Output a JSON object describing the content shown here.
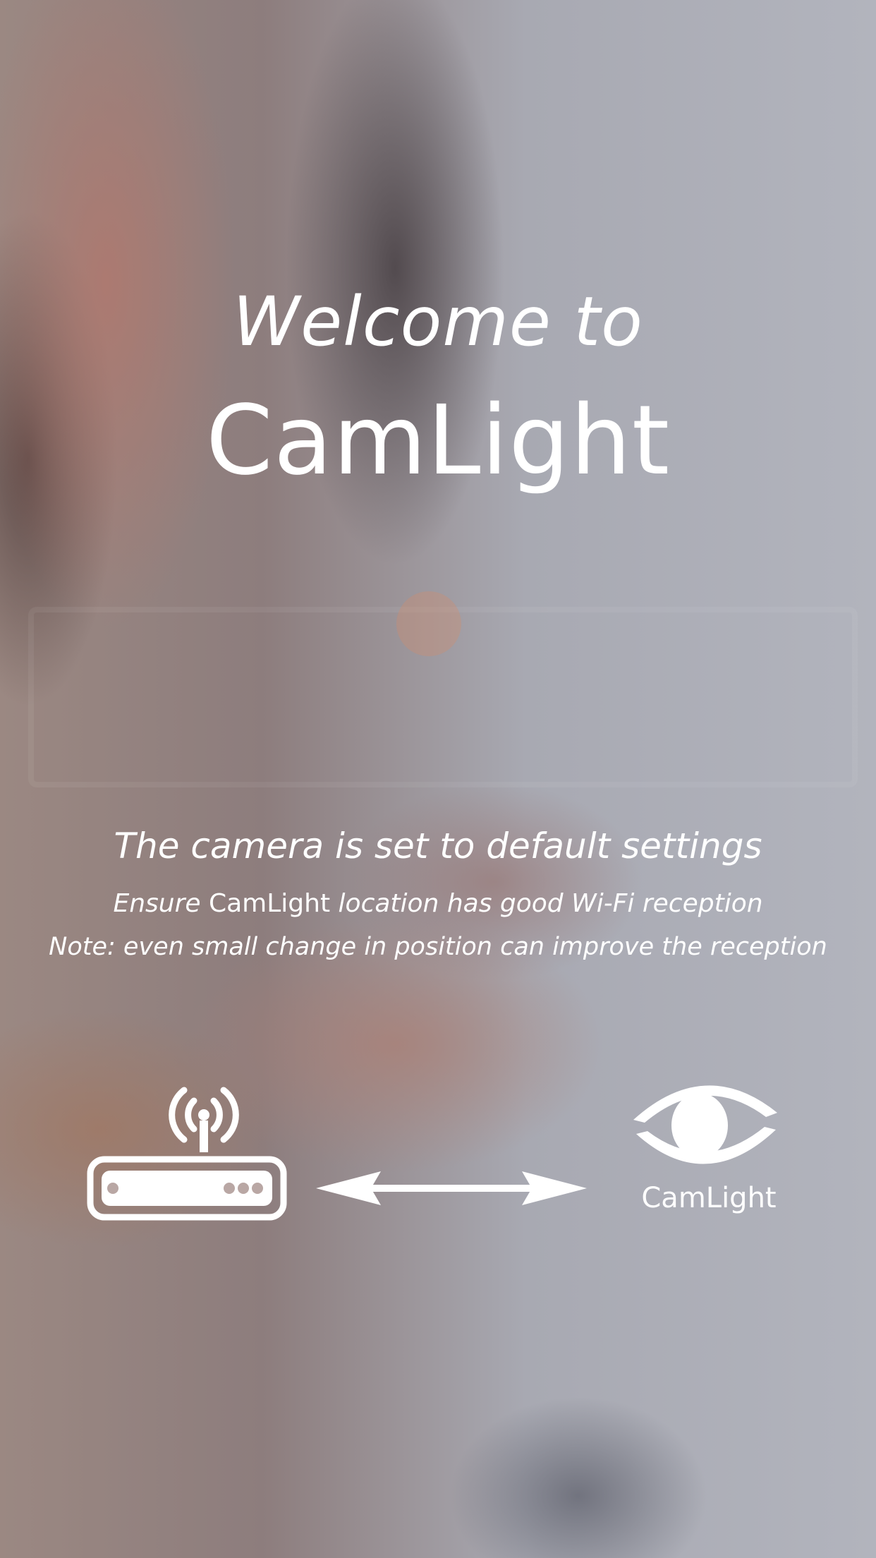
{
  "welcome": {
    "line1": "Welcome to",
    "line2": "CamLight"
  },
  "info": {
    "title": "The camera is set to default settings",
    "ensure_prefix": "Ensure ",
    "ensure_brand": "CamLight",
    "ensure_suffix": " location has good Wi-Fi reception",
    "note": "Note: even small change in position can improve the reception"
  },
  "diagram": {
    "router_icon": "wifi-router-icon",
    "arrow_icon": "double-arrow-icon",
    "logo_icon": "camlight-eye-logo-icon",
    "logo_label": "CamLight"
  },
  "colors": {
    "text": "#ffffff"
  }
}
